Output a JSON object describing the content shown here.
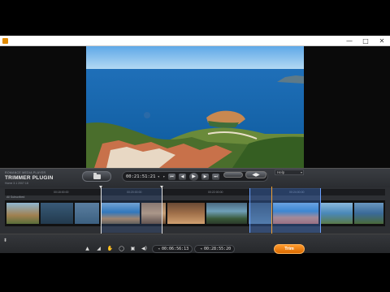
{
  "window": {
    "minimize_glyph": "—",
    "maximize_glyph": "□",
    "close_glyph": "✕"
  },
  "app": {
    "brand_line": "ROMANCE MEDIA PLAYER",
    "plugin_title": "TRIMMER PLUGIN",
    "version": "Home 3.1 2007.18"
  },
  "transport": {
    "timecode": "00:21:51:21",
    "prev_arrow": "◂",
    "next_arrow": "▸",
    "skip_start": "⏮",
    "step_back": "◀",
    "play": "▶",
    "step_forward": "▶",
    "skip_end": "⏭"
  },
  "controls": {
    "volume_glyph": "◀▶",
    "help_label": "Help"
  },
  "timeline": {
    "track_label": "All Subscribed",
    "ruler_labels": [
      "00:18:00:00",
      "00:20:00:00",
      "00:22:00:00",
      "00:24:00:00"
    ],
    "selections": [
      {
        "start_fraction": 0.25,
        "end_fraction": 0.41
      },
      {
        "start_fraction": 0.64,
        "end_fraction": 0.82
      }
    ]
  },
  "bottom_bar": {
    "collapse_glyph": "⬍",
    "tools": [
      "▲",
      "◢",
      "✋",
      "◯",
      "▣",
      "◀)"
    ],
    "timecode_in": "00:06:56:13",
    "timecode_out": "00:28:55:20",
    "trim_label": "Trim"
  },
  "colors": {
    "accent": "#f08a10",
    "selection": "#4682e6",
    "panel": "#2d2f33"
  }
}
